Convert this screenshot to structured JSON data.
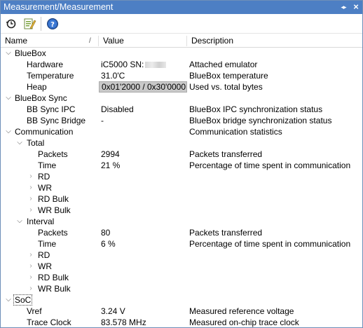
{
  "window": {
    "title": "Measurement/Measurement",
    "arrows_glyph": "◂▸",
    "close_glyph": "×"
  },
  "toolbar": {
    "refresh_icon": "history-refresh-icon",
    "options_icon": "options-edit-icon",
    "help_icon": "help-icon"
  },
  "columns": {
    "name": "Name",
    "sort_indicator": "/",
    "value": "Value",
    "description": "Description"
  },
  "rows": [
    {
      "name": "BlueBox",
      "value": "",
      "desc": "",
      "expanded": true,
      "has_children": true
    },
    {
      "name": "Hardware",
      "value": "iC5000  SN:",
      "desc": "Attached emulator",
      "masked": true
    },
    {
      "name": "Temperature",
      "value": "31.0'C",
      "desc": "BlueBox temperature"
    },
    {
      "name": "Heap",
      "value": "0x01'2000 / 0x30'0000",
      "desc": "Used vs. total bytes",
      "selected": true
    },
    {
      "name": "BlueBox Sync",
      "value": "",
      "desc": "",
      "expanded": true,
      "has_children": true
    },
    {
      "name": "BB Sync IPC",
      "value": "Disabled",
      "desc": "BlueBox IPC synchronization status"
    },
    {
      "name": "BB Sync Bridge",
      "value": "-",
      "desc": "BlueBox bridge synchronization status"
    },
    {
      "name": "Communication",
      "value": "",
      "desc": "Communication statistics",
      "expanded": true,
      "has_children": true
    },
    {
      "name": "Total",
      "value": "",
      "desc": "",
      "expanded": true,
      "has_children": true
    },
    {
      "name": "Packets",
      "value": "2994",
      "desc": "Packets transferred"
    },
    {
      "name": "Time",
      "value": "21 %",
      "desc": "Percentage of time spent in communication"
    },
    {
      "name": "RD",
      "value": "",
      "desc": "",
      "expanded": false,
      "has_children": true
    },
    {
      "name": "WR",
      "value": "",
      "desc": "",
      "expanded": false,
      "has_children": true
    },
    {
      "name": "RD Bulk",
      "value": "",
      "desc": "",
      "expanded": false,
      "has_children": true
    },
    {
      "name": "WR Bulk",
      "value": "",
      "desc": "",
      "expanded": false,
      "has_children": true
    },
    {
      "name": "Interval",
      "value": "",
      "desc": "",
      "expanded": true,
      "has_children": true
    },
    {
      "name": "Packets",
      "value": "80",
      "desc": "Packets transferred"
    },
    {
      "name": "Time",
      "value": "6 %",
      "desc": "Percentage of time spent in communication"
    },
    {
      "name": "RD",
      "value": "",
      "desc": "",
      "expanded": false,
      "has_children": true
    },
    {
      "name": "WR",
      "value": "",
      "desc": "",
      "expanded": false,
      "has_children": true
    },
    {
      "name": "RD Bulk",
      "value": "",
      "desc": "",
      "expanded": false,
      "has_children": true
    },
    {
      "name": "WR Bulk",
      "value": "",
      "desc": "",
      "expanded": false,
      "has_children": true
    },
    {
      "name": "SoC",
      "value": "",
      "desc": "",
      "expanded": true,
      "has_children": true,
      "focused": true
    },
    {
      "name": "Vref",
      "value": "3.24 V",
      "desc": "Measured reference voltage"
    },
    {
      "name": "Trace Clock",
      "value": "83.578 MHz",
      "desc": "Measured on-chip trace clock"
    }
  ],
  "colors": {
    "titlebar": "#4d7fc4",
    "selection": "#c9c9c9",
    "chevron": "#555555"
  }
}
